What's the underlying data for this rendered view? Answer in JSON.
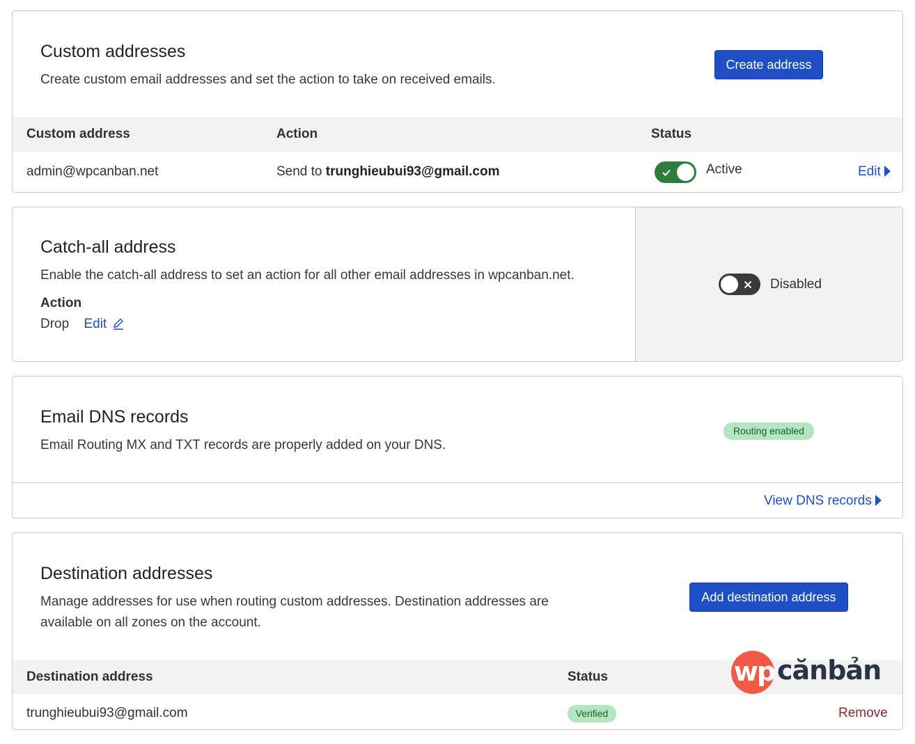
{
  "custom_addresses": {
    "title": "Custom addresses",
    "description": "Create custom email addresses and set the action to take on received emails.",
    "create_button": "Create address",
    "columns": {
      "address": "Custom address",
      "action": "Action",
      "status": "Status"
    },
    "rows": [
      {
        "address": "admin@wpcanban.net",
        "action_prefix": "Send to ",
        "action_target": "trunghieubui93@gmail.com",
        "status": "Active",
        "edit_label": "Edit"
      }
    ]
  },
  "catch_all": {
    "title": "Catch-all address",
    "description": "Enable the catch-all address to set an action for all other email addresses in wpcanban.net.",
    "action_label": "Action",
    "action_value": "Drop",
    "edit_label": "Edit",
    "status": "Disabled"
  },
  "dns_records": {
    "title": "Email DNS records",
    "description": "Email Routing MX and TXT records are properly added on your DNS.",
    "badge": "Routing enabled",
    "view_link": "View DNS records"
  },
  "destination_addresses": {
    "title": "Destination addresses",
    "description_line1": "Manage addresses for use when routing custom addresses. Destination addresses are",
    "description_line2": "available on all zones on the account.",
    "add_button": "Add destination address",
    "columns": {
      "address": "Destination address",
      "status": "Status"
    },
    "rows": [
      {
        "address": "trunghieubui93@gmail.com",
        "status": "Verified",
        "remove_label": "Remove"
      }
    ]
  },
  "watermark": {
    "mark": "wp",
    "text": "cănbản"
  },
  "colors": {
    "primary": "#1f4fc4",
    "toggle_on": "#2f7d3c",
    "toggle_off": "#3a3a3a",
    "badge_bg": "#b3e6be",
    "danger": "#8a2a2a",
    "logo_red": "#f15a45"
  }
}
